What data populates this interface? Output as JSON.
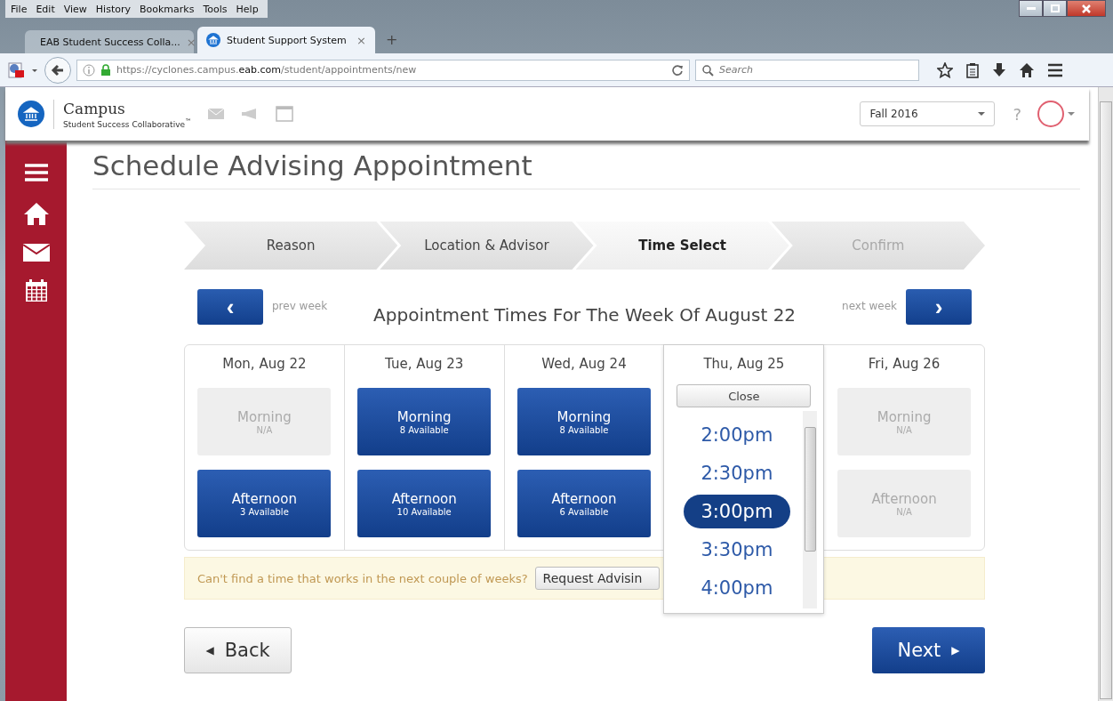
{
  "browser": {
    "menu": [
      "File",
      "Edit",
      "View",
      "History",
      "Bookmarks",
      "Tools",
      "Help"
    ],
    "tabs": [
      {
        "title": "EAB Student Success Colla...",
        "close": "×",
        "selected": false,
        "kind": "pdf"
      },
      {
        "title": "Student Support System",
        "close": "×",
        "selected": true,
        "kind": "campus"
      }
    ],
    "new_tab": "+",
    "url": {
      "host_before": "https://cyclones.campus.",
      "host_main": "eab.com",
      "path": "/student/appointments/new"
    },
    "search": {
      "placeholder": "Search"
    }
  },
  "app": {
    "brand": "Campus",
    "tagline": "Student Success Collaborative",
    "trademark": "™",
    "term": "Fall 2016",
    "help": "?"
  },
  "page": {
    "title": "Schedule Advising Appointment",
    "steps": [
      {
        "label": "Reason",
        "selected": false,
        "disabled": false
      },
      {
        "label": "Location & Advisor",
        "selected": false,
        "disabled": false
      },
      {
        "label": "Time Select",
        "selected": true,
        "disabled": false
      },
      {
        "label": "Confirm",
        "selected": false,
        "disabled": true
      }
    ],
    "prev_week": {
      "icon": "‹",
      "label": "prev week"
    },
    "week_title": "Appointment Times For The Week Of August 22",
    "next_week": {
      "icon": "›",
      "label": "next week"
    },
    "days": [
      {
        "label": "Mon, Aug 22",
        "slots": [
          {
            "name": "Morning",
            "availability": "N/A",
            "disabled": true
          },
          {
            "name": "Afternoon",
            "availability": "3 Available",
            "disabled": false
          }
        ]
      },
      {
        "label": "Tue, Aug 23",
        "slots": [
          {
            "name": "Morning",
            "availability": "8 Available",
            "disabled": false
          },
          {
            "name": "Afternoon",
            "availability": "10 Available",
            "disabled": false
          }
        ]
      },
      {
        "label": "Wed, Aug 24",
        "slots": [
          {
            "name": "Morning",
            "availability": "8 Available",
            "disabled": false
          },
          {
            "name": "Afternoon",
            "availability": "6 Available",
            "disabled": false
          }
        ]
      },
      {
        "label": "Thu, Aug 25",
        "picker": {
          "close": "Close",
          "times": [
            {
              "label": "2:00pm",
              "selected": false
            },
            {
              "label": "2:30pm",
              "selected": false
            },
            {
              "label": "3:00pm",
              "selected": true
            },
            {
              "label": "3:30pm",
              "selected": false
            },
            {
              "label": "4:00pm",
              "selected": false
            }
          ]
        }
      },
      {
        "label": "Fri, Aug 26",
        "slots": [
          {
            "name": "Morning",
            "availability": "N/A",
            "disabled": true
          },
          {
            "name": "Afternoon",
            "availability": "N/A",
            "disabled": true
          }
        ]
      }
    ],
    "notice": {
      "text": "Can't find a time that works in the next couple of weeks?",
      "button": "Request Advisin"
    },
    "back": {
      "icon": "◀",
      "label": "Back"
    },
    "next": {
      "label": "Next",
      "icon": "▶"
    }
  }
}
